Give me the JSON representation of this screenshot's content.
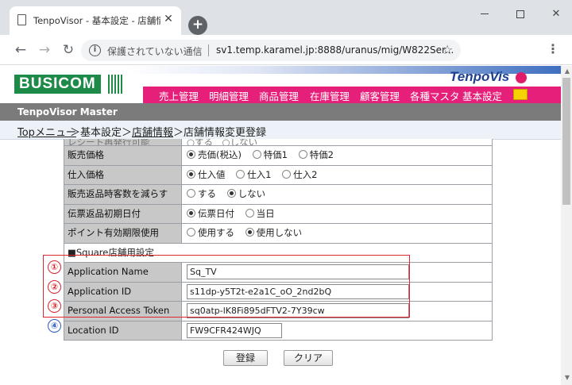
{
  "browser": {
    "tab_title": "TenpoVisor - 基本設定 - 店舗情報",
    "tab_close": "✕",
    "new_tab": "+",
    "security_text": "保護されていない通信",
    "url": "sv1.temp.karamel.jp:8888/uranus/mig/W822Ser...",
    "icons": {
      "back": "back-arrow-icon",
      "forward": "forward-arrow-icon",
      "reload": "reload-icon",
      "info": "info-icon",
      "star": "star-icon",
      "menu": "kebab-menu-icon"
    }
  },
  "header": {
    "logo_left": "BUSICOM",
    "logo_right": "TenpoVis",
    "master_title": "TenpoVisor Master",
    "brand_green": "#1d8a48",
    "menu_pink": "#e6207a",
    "menu": [
      {
        "label": "売上管理"
      },
      {
        "label": "明細管理"
      },
      {
        "label": "商品管理"
      },
      {
        "label": "在庫管理"
      },
      {
        "label": "顧客管理"
      },
      {
        "label": "各種マスタ"
      },
      {
        "label": "基本設定"
      }
    ]
  },
  "breadcrumb": {
    "top": "Topメニュー",
    "sep1": "＞",
    "base": "基本設定",
    "sep2": "＞",
    "store_info": "店舗情報",
    "sep3": "＞",
    "current": "店舗情報変更登録"
  },
  "settings": {
    "cut_row": {
      "label": "レシート再発行可能",
      "value": "○する　○しない"
    },
    "rows": [
      {
        "label": "販売価格",
        "options": [
          "売価(税込)",
          "特価1",
          "特価2"
        ],
        "selected": 0
      },
      {
        "label": "仕入価格",
        "options": [
          "仕入値",
          "仕入1",
          "仕入2"
        ],
        "selected": 0
      },
      {
        "label": "販売返品時客数を減らす",
        "options": [
          "する",
          "しない"
        ],
        "selected": 1
      },
      {
        "label": "伝票返品初期日付",
        "options": [
          "伝票日付",
          "当日"
        ],
        "selected": 0
      },
      {
        "label": "ポイント有効期限使用",
        "options": [
          "使用する",
          "使用しない"
        ],
        "selected": 1
      }
    ],
    "square_section": "■Square店舗用設定",
    "square_fields": [
      {
        "step": "①",
        "label": "Application Name",
        "value": "Sq_TV"
      },
      {
        "step": "②",
        "label": "Application ID",
        "value": "s11dp-y5T2t-e2a1C_oO_2nd2bQ"
      },
      {
        "step": "③",
        "label": "Personal Access Token",
        "value": "sq0atp-lK8Fi895dFTV2-7Y39cw"
      },
      {
        "step": "④",
        "label": "Location ID",
        "value": "FW9CFR424WJQ"
      }
    ]
  },
  "buttons": {
    "register": "登録",
    "clear": "クリア"
  }
}
